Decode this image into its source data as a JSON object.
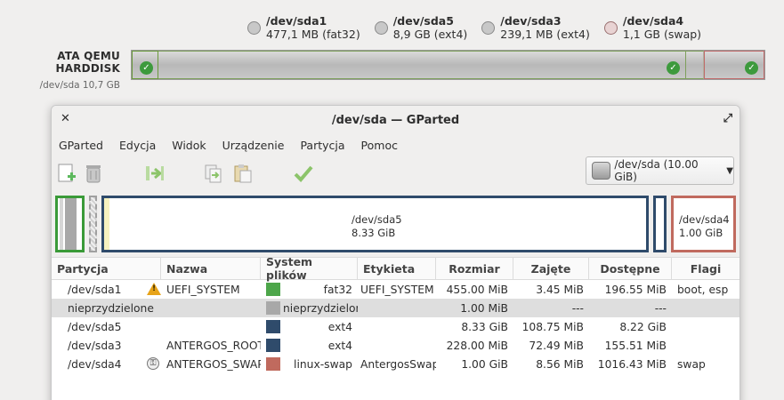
{
  "overview": {
    "disk_name": "ATA QEMU HARDDISK",
    "disk_path_size": "/dev/sda 10,7 GB",
    "legend": [
      {
        "name": "/dev/sda1",
        "detail": "477,1 MB (fat32)"
      },
      {
        "name": "/dev/sda5",
        "detail": "8,9 GB (ext4)"
      },
      {
        "name": "/dev/sda3",
        "detail": "239,1 MB (ext4)"
      },
      {
        "name": "/dev/sda4",
        "detail": "1,1 GB (swap)"
      }
    ],
    "colors": {
      "ok": "#3d9a3d",
      "swap_border": "#c06a6a"
    }
  },
  "window": {
    "title": "/dev/sda — GParted",
    "close_glyph": "✕",
    "maximize_glyph": "⤢"
  },
  "menu": [
    "GParted",
    "Edycja",
    "Widok",
    "Urządzenie",
    "Partycja",
    "Pomoc"
  ],
  "toolbar": {
    "icons": [
      "new-partition-icon",
      "delete-partition-icon",
      "resize-move-icon",
      "copy-icon",
      "paste-icon",
      "apply-icon"
    ],
    "device_select": "/dev/sda (10.00 GiB)"
  },
  "map": {
    "sda5": {
      "name": "/dev/sda5",
      "size": "8.33 GiB"
    },
    "sda4": {
      "name": "/dev/sda4",
      "size": "1.00 GiB"
    }
  },
  "table": {
    "headers": [
      "Partycja",
      "Nazwa",
      "System plików",
      "Etykieta",
      "Rozmiar",
      "Zajęte",
      "Dostępne",
      "Flagi"
    ],
    "rows": [
      {
        "partition": "/dev/sda1",
        "name": "UEFI_SYSTEM",
        "fs": "fat32",
        "fs_color": "#4da64a",
        "label": "UEFI_SYSTEM",
        "size": "455.00 MiB",
        "used": "3.45 MiB",
        "free": "196.55 MiB",
        "flags": "boot, esp",
        "icon": "warning-icon"
      },
      {
        "partition": "nieprzydzielone",
        "name": "",
        "fs": "nieprzydzielone",
        "fs_color": "#a8a8a8",
        "label": "",
        "size": "1.00 MiB",
        "used": "---",
        "free": "---",
        "flags": ""
      },
      {
        "partition": "/dev/sda5",
        "name": "",
        "fs": "ext4",
        "fs_color": "#2f4b6b",
        "label": "",
        "size": "8.33 GiB",
        "used": "108.75 MiB",
        "free": "8.22 GiB",
        "flags": ""
      },
      {
        "partition": "/dev/sda3",
        "name": "ANTERGOS_ROOT",
        "fs": "ext4",
        "fs_color": "#2f4b6b",
        "label": "",
        "size": "228.00 MiB",
        "used": "72.49 MiB",
        "free": "155.51 MiB",
        "flags": ""
      },
      {
        "partition": "/dev/sda4",
        "name": "ANTERGOS_SWAP",
        "fs": "linux-swap",
        "fs_color": "#c06a5e",
        "label": "AntergosSwap",
        "size": "1.00 GiB",
        "used": "8.56 MiB",
        "free": "1016.43 MiB",
        "flags": "swap",
        "icon": "key-icon"
      }
    ]
  }
}
